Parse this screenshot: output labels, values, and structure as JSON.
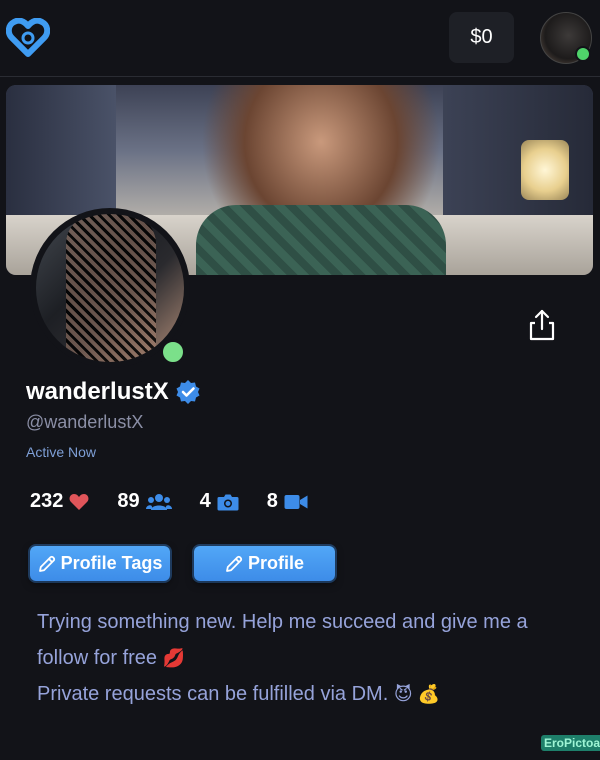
{
  "header": {
    "balance": "$0",
    "logo_icon": "heart-logo-icon",
    "avatar_icon": "user-avatar"
  },
  "profile": {
    "display_name": "wanderlustX",
    "handle": "@wanderlustX",
    "status": "Active Now",
    "verified": true
  },
  "stats": [
    {
      "value": "232",
      "icon": "heart-icon",
      "color": "#e0555a"
    },
    {
      "value": "89",
      "icon": "users-icon",
      "color": "#3d8ce8"
    },
    {
      "value": "4",
      "icon": "camera-icon",
      "color": "#3d8ce8"
    },
    {
      "value": "8",
      "icon": "video-icon",
      "color": "#3d8ce8"
    }
  ],
  "buttons": {
    "profile_tags": "Profile Tags",
    "profile": "Profile"
  },
  "bio": {
    "line1": "Trying something new. Help me succeed and give me a",
    "line2": "follow for free",
    "line2_emoji": "💋",
    "line3": "Private requests can be fulfilled via DM.",
    "line3_emojis": "😈 💰"
  },
  "watermark": "EroPictoa",
  "colors": {
    "background": "#121318",
    "accent": "#3d8ce8",
    "online": "#7be08a",
    "bio_text": "#96a3da"
  }
}
